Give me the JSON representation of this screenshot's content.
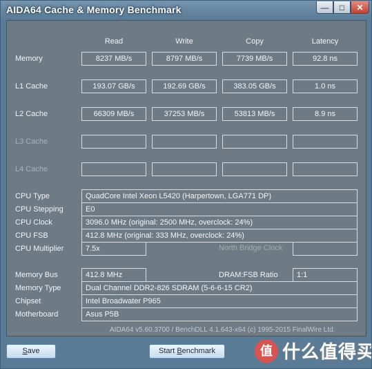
{
  "window": {
    "title": "AIDA64 Cache & Memory Benchmark",
    "min_glyph": "—",
    "max_glyph": "□",
    "close_glyph": "✕"
  },
  "columns": [
    "Read",
    "Write",
    "Copy",
    "Latency"
  ],
  "rows": [
    {
      "label": "Memory",
      "enabled": true,
      "values": [
        "8237 MB/s",
        "8797 MB/s",
        "7739 MB/s",
        "92.8 ns"
      ]
    },
    {
      "label": "L1 Cache",
      "enabled": true,
      "values": [
        "193.07 GB/s",
        "192.69 GB/s",
        "383.05 GB/s",
        "1.0 ns"
      ]
    },
    {
      "label": "L2 Cache",
      "enabled": true,
      "values": [
        "66309 MB/s",
        "37253 MB/s",
        "53813 MB/s",
        "8.9 ns"
      ]
    },
    {
      "label": "L3 Cache",
      "enabled": false,
      "values": [
        "",
        "",
        "",
        ""
      ]
    },
    {
      "label": "L4 Cache",
      "enabled": false,
      "values": [
        "",
        "",
        "",
        ""
      ]
    }
  ],
  "cpu": {
    "type_label": "CPU Type",
    "type_value": "QuadCore Intel Xeon L5420  (Harpertown, LGA771 DP)",
    "stepping_label": "CPU Stepping",
    "stepping_value": "E0",
    "clock_label": "CPU Clock",
    "clock_value": "3096.0 MHz  (original: 2500 MHz, overclock: 24%)",
    "fsb_label": "CPU FSB",
    "fsb_value": "412.8 MHz  (original: 333 MHz, overclock: 24%)",
    "multiplier_label": "CPU Multiplier",
    "multiplier_value": "7.5x",
    "north_bridge_label": "North Bridge Clock"
  },
  "memory": {
    "bus_label": "Memory Bus",
    "bus_value": "412.8 MHz",
    "ratio_label": "DRAM:FSB Ratio",
    "ratio_value": "1:1",
    "type_label": "Memory Type",
    "type_value": "Dual Channel DDR2-826 SDRAM  (5-6-6-15 CR2)",
    "chipset_label": "Chipset",
    "chipset_value": "Intel Broadwater P965",
    "motherboard_label": "Motherboard",
    "motherboard_value": "Asus P5B"
  },
  "footer": "AIDA64 v5.60.3700 / BenchDLL 4.1.643-x64  (c) 1995-2015 FinalWire Ltd.",
  "buttons": {
    "save_accel": "S",
    "save_rest": "ave",
    "start_pre": "Start ",
    "start_accel": "B",
    "start_rest": "enchmark"
  },
  "watermark": {
    "logo": "值",
    "text": "什么值得买"
  },
  "colors": {
    "frame": "#5a7b96",
    "panel": "#6e7a84",
    "close": "#c4412e"
  }
}
